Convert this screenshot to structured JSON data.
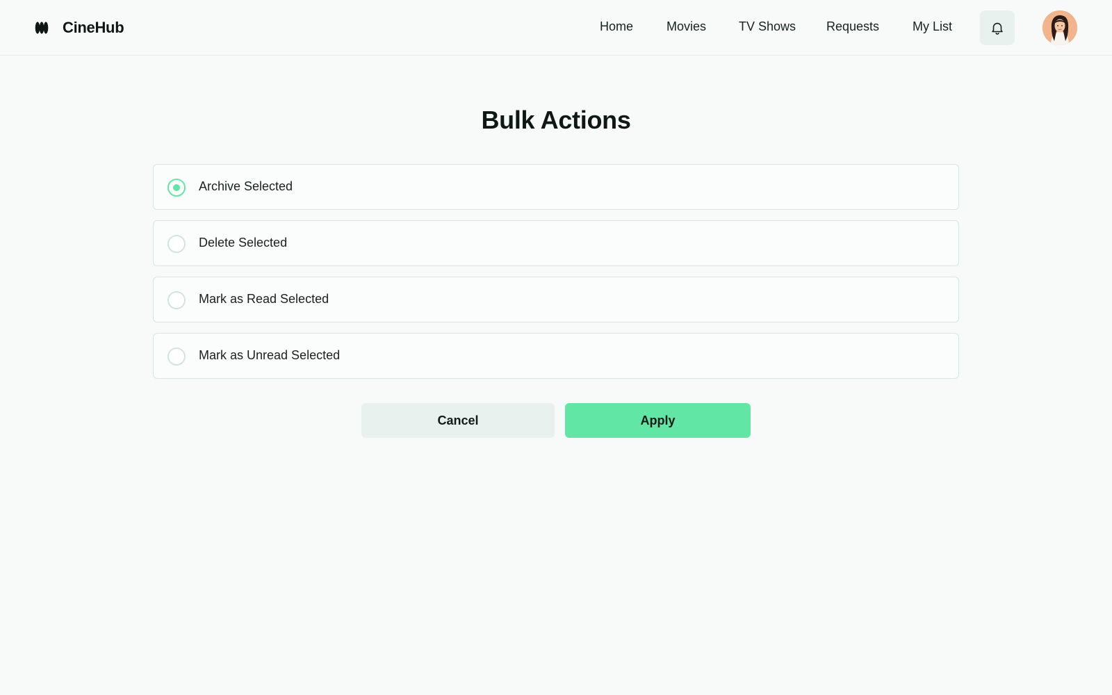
{
  "app": {
    "name": "CineHub",
    "logo_icon": "cinehub-logo-icon"
  },
  "nav": {
    "items": [
      {
        "label": "Home"
      },
      {
        "label": "Movies"
      },
      {
        "label": "TV Shows"
      },
      {
        "label": "Requests"
      },
      {
        "label": "My List"
      }
    ],
    "notifications_icon": "bell-icon",
    "avatar_icon": "user-avatar"
  },
  "page": {
    "title": "Bulk Actions"
  },
  "options": [
    {
      "label": "Archive Selected",
      "selected": true
    },
    {
      "label": "Delete Selected",
      "selected": false
    },
    {
      "label": "Mark as Read Selected",
      "selected": false
    },
    {
      "label": "Mark as Unread Selected",
      "selected": false
    }
  ],
  "buttons": {
    "cancel_label": "Cancel",
    "apply_label": "Apply"
  },
  "colors": {
    "accent": "#62e6a5",
    "background": "#f8fafa",
    "secondary_button": "#e8f1ed",
    "border": "#d6e6e0"
  }
}
